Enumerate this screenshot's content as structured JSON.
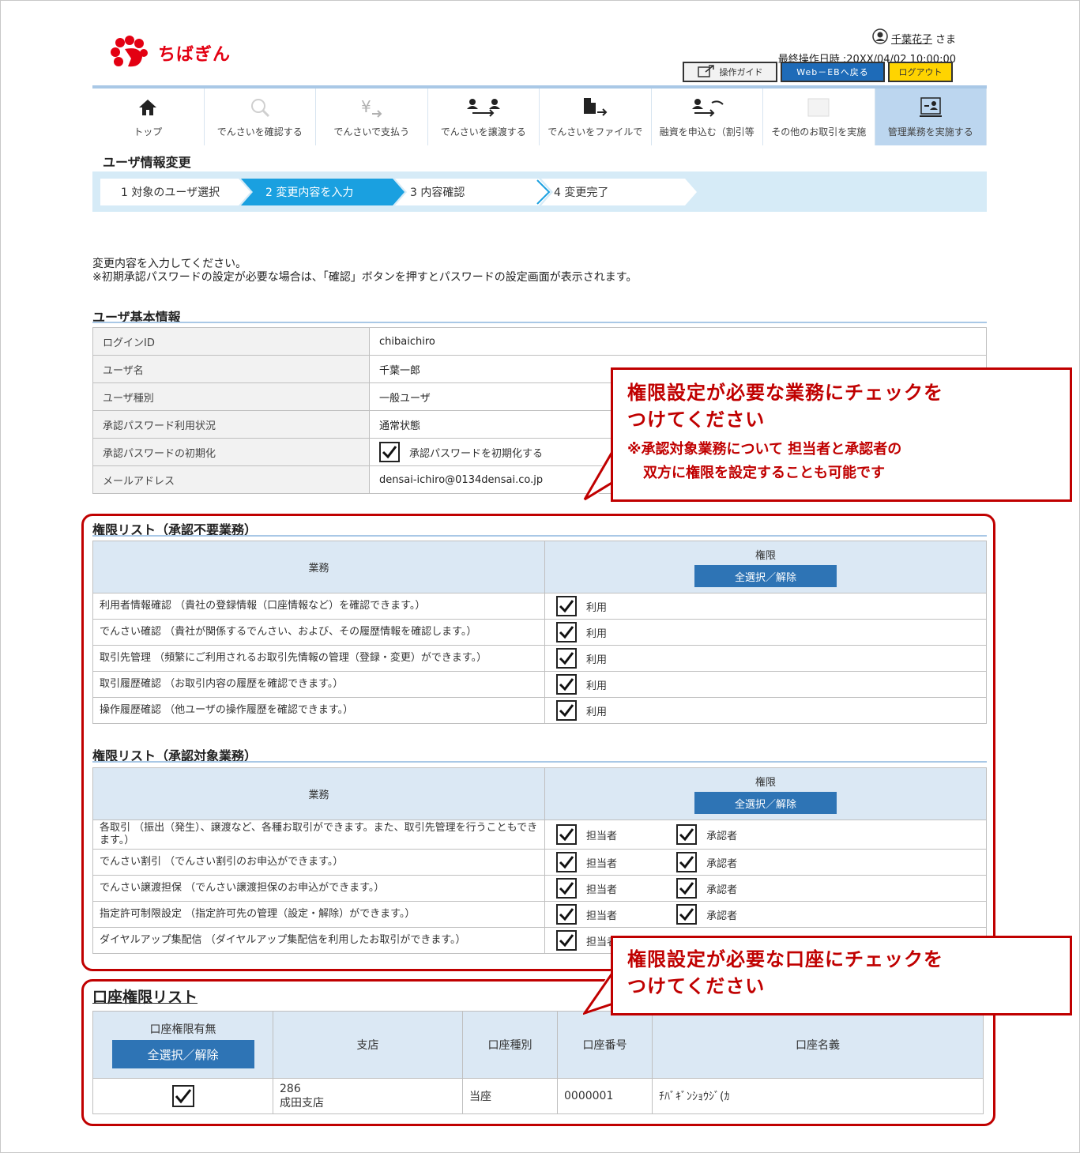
{
  "header": {
    "logo_text": "ちばぎん",
    "user_name": "千葉花子",
    "user_suffix": "さま",
    "last_op": "最終操作日時 :20XX/04/02 10:00:00",
    "btn_guide": "操作ガイド",
    "btn_web": "Web－EBへ戻る",
    "btn_logout": "ログアウト"
  },
  "nav": {
    "items": [
      {
        "label": "トップ",
        "icon": "home-icon"
      },
      {
        "label": "でんさいを確認する",
        "icon": "search-icon"
      },
      {
        "label": "でんさいで支払う",
        "icon": "yen-icon"
      },
      {
        "label": "でんさいを譲渡する",
        "icon": "transfer-icon"
      },
      {
        "label": "でんさいをファイルで",
        "icon": "file-icon"
      },
      {
        "label": "融資を申込む（割引等",
        "icon": "loan-icon"
      },
      {
        "label": "その他のお取引を実施",
        "icon": "other-icon"
      },
      {
        "label": "管理業務を実施する",
        "icon": "admin-icon"
      }
    ]
  },
  "page_title": "ユーザ情報変更",
  "steps": [
    "1 対象のユーザ選択",
    "2 変更内容を入力",
    "3 内容確認",
    "4 変更完了"
  ],
  "intro": {
    "line1": "変更内容を入力してください。",
    "line2": "※初期承認パスワードの設定が必要な場合は、「確認」ボタンを押すとパスワードの設定画面が表示されます。"
  },
  "basic": {
    "title": "ユーザ基本情報",
    "rows": [
      {
        "k": "ログインID",
        "v": "chibaichiro"
      },
      {
        "k": "ユーザ名",
        "v": "千葉一郎"
      },
      {
        "k": "ユーザ種別",
        "v": "一般ユーザ"
      },
      {
        "k": "承認パスワード利用状況",
        "v": "通常状態"
      },
      {
        "k": "承認パスワードの初期化",
        "v": "承認パスワードを初期化する"
      },
      {
        "k": "メールアドレス",
        "v": "densai-ichiro@0134densai.co.jp"
      }
    ]
  },
  "perm1": {
    "title": "権限リスト（承認不要業務）",
    "col_job": "業務",
    "col_perm": "権限",
    "select_all": "全選択／解除",
    "use_label": "利用",
    "rows": [
      "利用者情報確認 （貴社の登録情報（口座情報など）を確認できます。）",
      "でんさい確認 （貴社が関係するでんさい、および、その履歴情報を確認します。）",
      "取引先管理 （頻繁にご利用されるお取引先情報の管理（登録・変更）ができます。）",
      "取引履歴確認 （お取引内容の履歴を確認できます。）",
      "操作履歴確認 （他ユーザの操作履歴を確認できます。）"
    ]
  },
  "perm2": {
    "title": "権限リスト（承認対象業務）",
    "col_job": "業務",
    "col_perm": "権限",
    "select_all": "全選択／解除",
    "tanto_label": "担当者",
    "shonin_label": "承認者",
    "rows": [
      "各取引 （振出（発生）、譲渡など、各種お取引ができます。また、取引先管理を行うこともできます。）",
      "でんさい割引 （でんさい割引のお申込ができます。）",
      "でんさい譲渡担保 （でんさい譲渡担保のお申込ができます。）",
      "指定許可制限設定 （指定許可先の管理（設定・解除）ができます。）",
      "ダイヤルアップ集配信 （ダイヤルアップ集配信を利用したお取引ができます。）"
    ]
  },
  "acct": {
    "title": "口座権限リスト",
    "col_flag": "口座権限有無",
    "select_all": "全選択／解除",
    "col_branch": "支店",
    "col_type": "口座種別",
    "col_number": "口座番号",
    "col_name": "口座名義",
    "row": {
      "branch_code": "286",
      "branch_name": "成田支店",
      "type": "当座",
      "number": "0000001",
      "name": "ﾁﾊﾞｷﾞﾝｼｮｳｼﾞ(ｶ"
    }
  },
  "callout1": {
    "line1": "権限設定が必要な業務にチェックを",
    "line2": "つけてください",
    "note1": "※承認対象業務について 担当者と承認者の",
    "note2": "双方に権限を設定することも可能です"
  },
  "callout2": {
    "line1": "権限設定が必要な口座にチェックを",
    "line2": "つけてください"
  },
  "colors": {
    "accent": "#2e74b5",
    "red": "#c00000",
    "nav_active": "#bcd6ef",
    "step_active": "#1aa0e0"
  }
}
